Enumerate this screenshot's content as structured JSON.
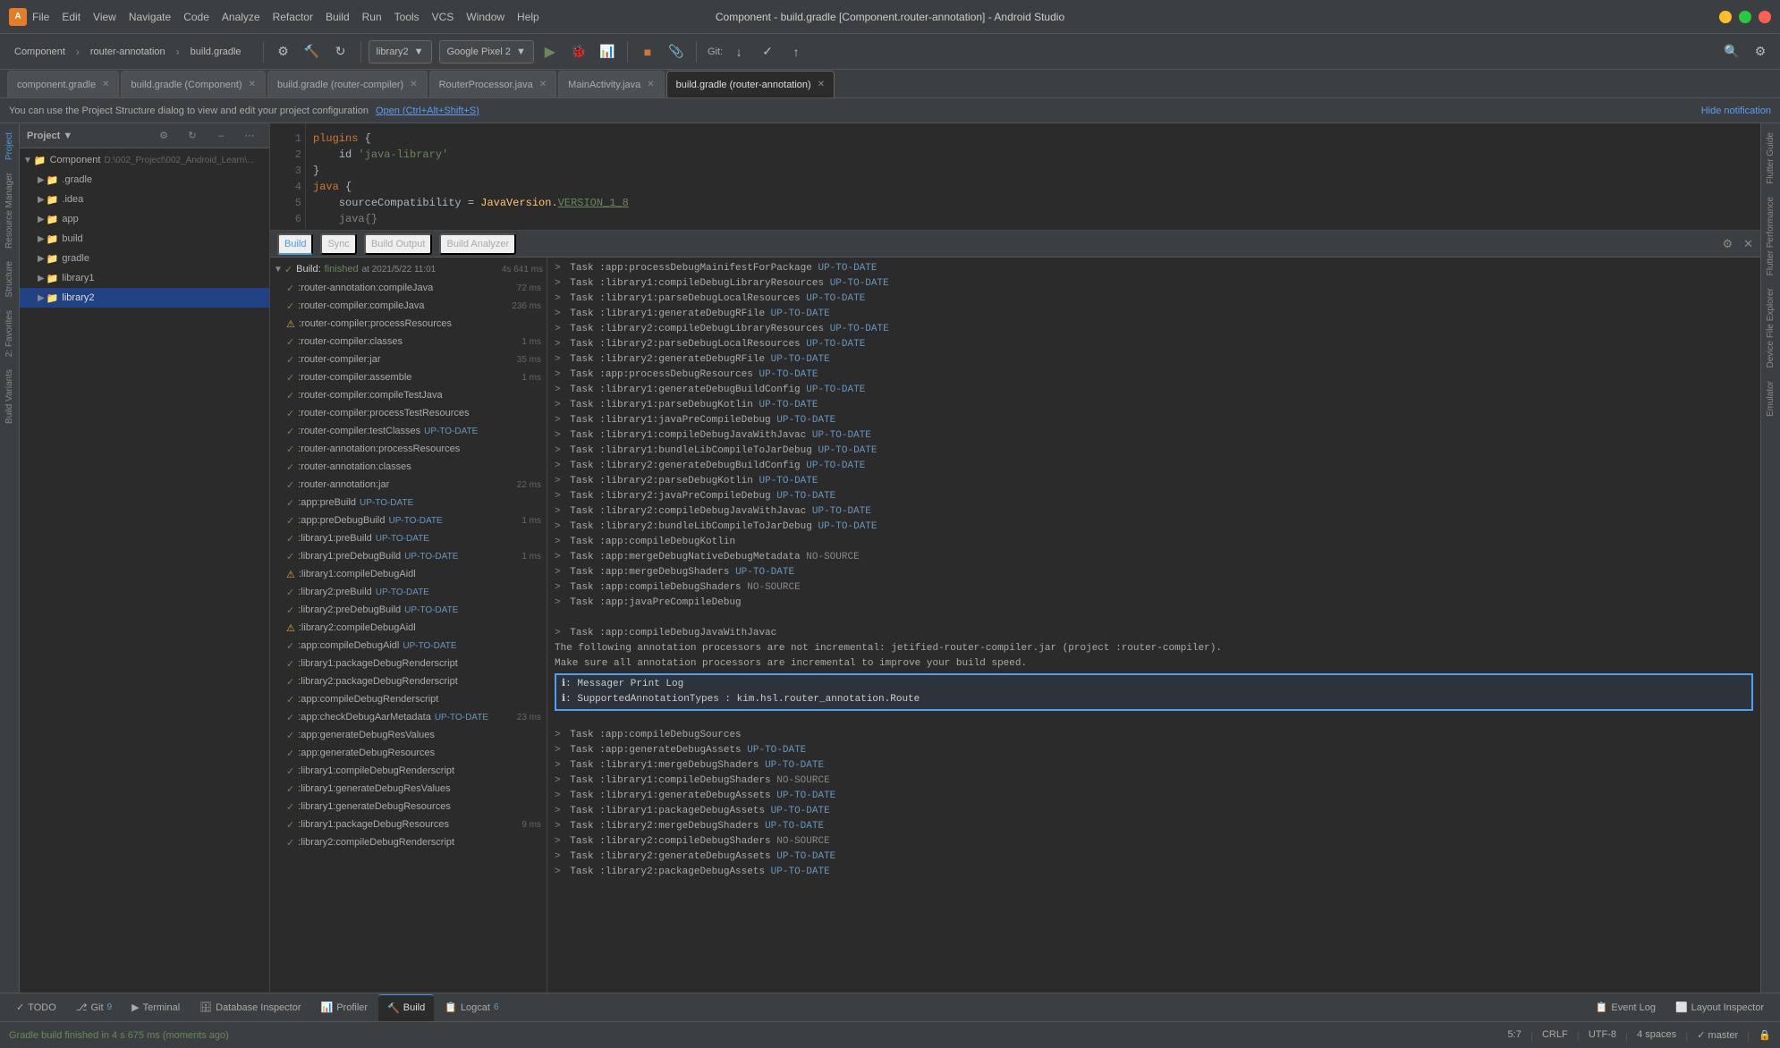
{
  "titlebar": {
    "app_name": "Component",
    "separator1": "›",
    "module": "router-annotation",
    "separator2": "›",
    "file": "build.gradle",
    "window_title": "Component - build.gradle [Component.router-annotation] - Android Studio",
    "close_btn": "✕",
    "min_btn": "–",
    "max_btn": "□"
  },
  "menus": [
    "File",
    "Edit",
    "View",
    "Navigate",
    "Code",
    "Analyze",
    "Refactor",
    "Build",
    "Run",
    "Tools",
    "VCS",
    "Window",
    "Help"
  ],
  "toolbar": {
    "breadcrumb": "Component  router-annotation  build.gradle",
    "run_config": "library2",
    "device": "Google Pixel 2",
    "git_label": "Git:",
    "search_icon": "🔍"
  },
  "tabs": [
    {
      "label": "component.gradle",
      "active": false
    },
    {
      "label": "build.gradle (Component)",
      "active": false
    },
    {
      "label": "build.gradle (router-compiler)",
      "active": false
    },
    {
      "label": "RouterProcessor.java",
      "active": false
    },
    {
      "label": "MainActivity.java",
      "active": false
    },
    {
      "label": "build.gradle (router-annotation)",
      "active": true
    }
  ],
  "notification": {
    "text": "You can use the Project Structure dialog to view and edit your project configuration",
    "link": "Open (Ctrl+Alt+Shift+S)",
    "hide": "Hide notification"
  },
  "project_panel": {
    "title": "Project",
    "view_selector": "Project ▼",
    "root": "Component",
    "path": "D:\\002_Project\\002_Android_Learn\\...",
    "items": [
      {
        "label": ".gradle",
        "icon": "folder",
        "indent": 1,
        "arrow": "▶"
      },
      {
        "label": ".idea",
        "icon": "folder",
        "indent": 1,
        "arrow": "▶"
      },
      {
        "label": "app",
        "icon": "folder",
        "indent": 1,
        "arrow": "▶"
      },
      {
        "label": "build",
        "icon": "folder",
        "indent": 1,
        "arrow": "▶"
      },
      {
        "label": "gradle",
        "icon": "folder",
        "indent": 1,
        "arrow": "▶"
      },
      {
        "label": "library1",
        "icon": "folder",
        "indent": 1,
        "arrow": "▶"
      },
      {
        "label": "library2",
        "icon": "folder",
        "indent": 1,
        "arrow": "▶"
      }
    ]
  },
  "code": {
    "lines": [
      {
        "num": 1,
        "text": "plugins {",
        "type": "normal"
      },
      {
        "num": 2,
        "text": "    id 'java-library'",
        "type": "string"
      },
      {
        "num": 3,
        "text": "}",
        "type": "normal"
      },
      {
        "num": 4,
        "text": "",
        "type": "normal"
      },
      {
        "num": 5,
        "text": "java {",
        "type": "normal"
      },
      {
        "num": 6,
        "text": "    sourceCompatibility = JavaVersion.VERSION_1_8",
        "type": "normal"
      }
    ]
  },
  "build_panel": {
    "tabs": [
      {
        "label": "Build",
        "active": true
      },
      {
        "label": "Sync",
        "active": false
      },
      {
        "label": "Build Output",
        "active": false
      },
      {
        "label": "Build Analyzer",
        "active": false
      }
    ],
    "build_header": {
      "label": "Build:",
      "status": "finished",
      "time": "at 2021/5/22 11:01",
      "duration": "4s 641 ms"
    },
    "tree_items": [
      {
        "label": ":router-annotation:compileJava",
        "status": "success",
        "time": "72 ms"
      },
      {
        "label": ":router-compiler:compileJava",
        "status": "success",
        "time": "236 ms"
      },
      {
        "label": ":router-compiler:processResources",
        "status": "success",
        "time": ""
      },
      {
        "label": ":router-compiler:classes",
        "status": "success",
        "time": "1 ms"
      },
      {
        "label": ":router-compiler:jar",
        "status": "success",
        "time": "35 ms"
      },
      {
        "label": ":router-compiler:assemble",
        "status": "success",
        "time": "1 ms"
      },
      {
        "label": ":router-compiler:compileTestJava",
        "status": "success",
        "time": ""
      },
      {
        "label": ":router-compiler:processTestResources",
        "status": "success",
        "time": ""
      },
      {
        "label": ":router-compiler:testClasses UP-TO-DATE",
        "status": "success",
        "time": ""
      },
      {
        "label": ":router-annotation:processResources",
        "status": "success",
        "time": ""
      },
      {
        "label": ":router-annotation:classes",
        "status": "success",
        "time": ""
      },
      {
        "label": ":router-annotation:jar",
        "status": "success",
        "time": "22 ms"
      },
      {
        "label": ":app:preBuild UP-TO-DATE",
        "status": "success",
        "time": ""
      },
      {
        "label": ":app:preDebugBuild UP-TO-DATE",
        "status": "success",
        "time": "1 ms"
      },
      {
        "label": ":library1:preBuild UP-TO-DATE",
        "status": "success",
        "time": ""
      },
      {
        "label": ":library1:preDebugBuild UP-TO-DATE",
        "status": "success",
        "time": "1 ms"
      },
      {
        "label": ":library1:compileDebugAidl",
        "status": "warning",
        "time": ""
      },
      {
        "label": ":library2:preBuild UP-TO-DATE",
        "status": "success",
        "time": ""
      },
      {
        "label": ":library2:preDebugBuild UP-TO-DATE",
        "status": "success",
        "time": ""
      },
      {
        "label": ":library2:compileDebugAidl",
        "status": "warning",
        "time": ""
      },
      {
        "label": ":app:compileDebugAidl UP-TO-DATE",
        "status": "success",
        "time": ""
      },
      {
        "label": ":library1:packageDebugRenderscript",
        "status": "success",
        "time": ""
      },
      {
        "label": ":library2:packageDebugRenderscript",
        "status": "success",
        "time": ""
      },
      {
        "label": ":app:compileDebugRenderscript",
        "status": "success",
        "time": ""
      },
      {
        "label": ":app:checkDebugAarMetadata UP-TO-DATE",
        "status": "success",
        "time": "23 ms"
      },
      {
        "label": ":app:generateDebugResValues",
        "status": "success",
        "time": ""
      },
      {
        "label": ":app:generateDebugResources",
        "status": "success",
        "time": ""
      },
      {
        "label": ":library1:compileDebugRenderscript",
        "status": "success",
        "time": ""
      },
      {
        "label": ":library1:generateDebugResValues",
        "status": "success",
        "time": ""
      },
      {
        "label": ":library1:generateDebugResources",
        "status": "success",
        "time": ""
      },
      {
        "label": ":library1:packageDebugResources",
        "status": "success",
        "time": "9 ms"
      },
      {
        "label": ":library2:compileDebugRenderscript",
        "status": "success",
        "time": ""
      }
    ],
    "output_lines": [
      "> Task :app:processDebugMainifestForPackage UP-TO-DATE",
      "> Task :library1:compileDebugLibraryResources UP-TO-DATE",
      "> Task :library1:parseDebugLocalResources UP-TO-DATE",
      "> Task :library1:generateDebugRFile UP-TO-DATE",
      "> Task :library2:compileDebugLibraryResources UP-TO-DATE",
      "> Task :library2:parseDebugLocalResources UP-TO-DATE",
      "> Task :library2:generateDebugRFile UP-TO-DATE",
      "> Task :app:processDebugResources UP-TO-DATE",
      "> Task :library1:generateDebugBuildConfig UP-TO-DATE",
      "> Task :library1:parseDebugKotlin UP-TO-DATE",
      "> Task :library1:javaPreCompileDebug UP-TO-DATE",
      "> Task :library1:compileDebugJavaWithJavac UP-TO-DATE",
      "> Task :library1:bundleLibCompileToJarDebug UP-TO-DATE",
      "> Task :library2:generateDebugBuildConfig UP-TO-DATE",
      "> Task :library2:parseDebugKotlin UP-TO-DATE",
      "> Task :library2:javaPreCompileDebug UP-TO-DATE",
      "> Task :library2:compileDebugJavaWithJavac UP-TO-DATE",
      "> Task :library2:bundleLibCompileToJarDebug UP-TO-DATE",
      "> Task :app:compileDebugKotlin",
      "> Task :app:mergeDebugNativeDebugMetadata NO-SOURCE",
      "> Task :app:mergeDebugShaders UP-TO-DATE",
      "> Task :app:compileDebugShaders NO-SOURCE",
      "> Task :app:javaPreCompileDebug",
      "",
      "> Task :app:compileDebugJavaWithJavac",
      "The following annotation processors are not incremental: jetified-router-compiler.jar (project :router-compiler).",
      "Make sure all annotation processors are incremental to improve your build speed.",
      "",
      "highlight_start",
      "ℹ: Messager Print Log",
      "ℹ: SupportedAnnotationTypes : kim.hsl.router_annotation.Route",
      "highlight_end",
      "",
      "> Task :app:compileDebugSources",
      "> Task :app:generateDebugAssets UP-TO-DATE",
      "> Task :library1:mergeDebugShaders UP-TO-DATE",
      "> Task :library1:compileDebugShaders NO-SOURCE",
      "> Task :library1:generateDebugAssets UP-TO-DATE",
      "> Task :library1:packageDebugAssets UP-TO-DATE",
      "> Task :library2:mergeDebugShaders UP-TO-DATE",
      "> Task :library2:compileDebugShaders NO-SOURCE",
      "> Task :library2:generateDebugAssets UP-TO-DATE",
      "> Task :library2:packageDebugAssets UP-TO-DATE"
    ]
  },
  "bottom_tabs": [
    {
      "label": "TODO",
      "icon": "✓",
      "active": false
    },
    {
      "label": "Git",
      "icon": "⎇",
      "num": "9",
      "active": false
    },
    {
      "label": "Terminal",
      "icon": "▶",
      "active": false
    },
    {
      "label": "Database Inspector",
      "icon": "🗄",
      "active": false
    },
    {
      "label": "Profiler",
      "icon": "📊",
      "active": false
    },
    {
      "label": "Build",
      "icon": "🔨",
      "active": true
    },
    {
      "label": "Logcat",
      "icon": "📋",
      "num": "6",
      "active": false
    }
  ],
  "status_bar": {
    "message": "Gradle build finished in 4 s 675 ms (moments ago)",
    "position": "5:7",
    "line_sep": "CRLF",
    "encoding": "UTF-8",
    "indent": "4 spaces",
    "branch": "✓ master",
    "right_panels": [
      "Event Log",
      "Layout Inspector"
    ]
  },
  "right_vertical_panels": [
    "Flutter Guide",
    "Flutter Performance",
    "Device File Explorer",
    "Emulator"
  ],
  "left_vertical_panels": [
    "Project",
    "Resource Manager",
    "Structure",
    "2: Favorites",
    "Build Variants"
  ]
}
